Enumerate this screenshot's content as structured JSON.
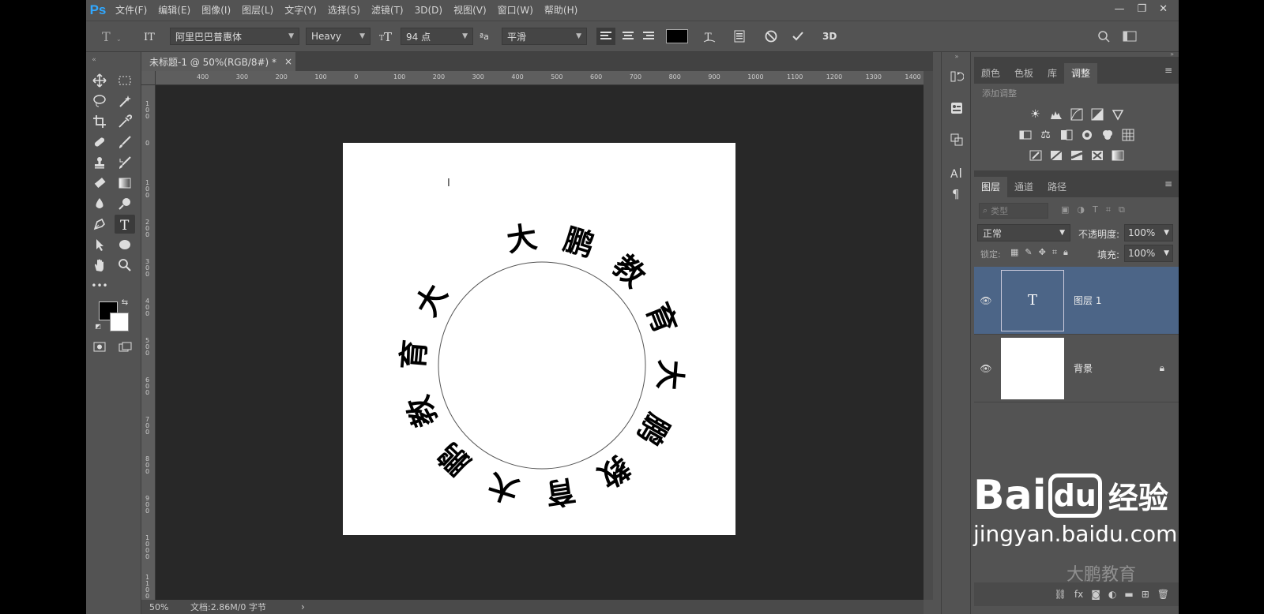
{
  "app": {
    "logo": "Ps",
    "menus": [
      "文件(F)",
      "编辑(E)",
      "图像(I)",
      "图层(L)",
      "文字(Y)",
      "选择(S)",
      "滤镜(T)",
      "3D(D)",
      "视图(V)",
      "窗口(W)",
      "帮助(H)"
    ],
    "window_buttons": [
      "—",
      "❐",
      "✕"
    ]
  },
  "options": {
    "font_family": "阿里巴巴普惠体",
    "font_style": "Heavy",
    "font_size": "94 点",
    "aa_label": "ªa",
    "antialias": "平滑",
    "threeD": "3D",
    "text_color": "#000000"
  },
  "document": {
    "tab_title": "未标题-1 @ 50%(RGB/8#) *",
    "tab_close": "×",
    "ruler_top": [
      "400",
      "300",
      "200",
      "100",
      "0",
      "100",
      "200",
      "300",
      "400",
      "500",
      "600",
      "700",
      "800",
      "900",
      "1000",
      "1100",
      "1200",
      "1300",
      "1400"
    ],
    "ruler_left": [
      "1 0 0",
      "0",
      "1 0 0",
      "2 0 0",
      "3 0 0",
      "4 0 0",
      "5 0 0",
      "6 0 0",
      "7 0 0",
      "8 0 0",
      "9 0 0",
      "1 0 0 0",
      "1 1 0 0"
    ],
    "circle_text": "大鹏教育大鹏教育大鹏教育大",
    "zoom": "50%",
    "doc_info": "文档:2.86M/0 字节",
    "status_arrow": "›"
  },
  "panels": {
    "top_tabs": [
      "颜色",
      "色板",
      "库",
      "调整"
    ],
    "active_top_tab": "调整",
    "adjust_label": "添加调整",
    "layer_tabs": [
      "图层",
      "通道",
      "路径"
    ],
    "filter_kind": "类型",
    "blend_mode": "正常",
    "opacity_label": "不透明度:",
    "opacity_value": "100%",
    "lock_label": "锁定:",
    "fill_label": "填充:",
    "fill_value": "100%",
    "layers": [
      {
        "name": "图层 1",
        "type": "text",
        "thumb": "T",
        "selected": true
      },
      {
        "name": "背景",
        "type": "background",
        "thumb": "",
        "locked": true
      }
    ],
    "menu_icon": "≡"
  },
  "watermark": {
    "brand": "Bai",
    "brand_du": "du",
    "suffix": "经验",
    "url": "jingyan.baidu.com",
    "sub": "大鹏教育"
  }
}
